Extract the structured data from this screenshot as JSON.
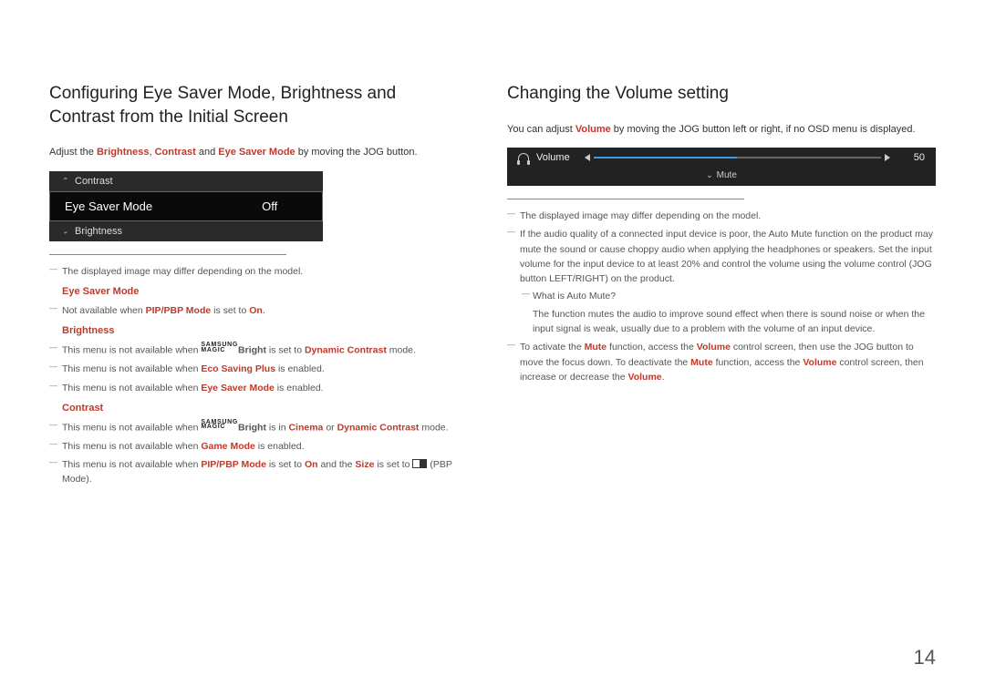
{
  "left": {
    "heading": "Configuring Eye Saver Mode, Brightness and Contrast from the Initial Screen",
    "intro_pre": "Adjust the ",
    "intro_b": "Brightness",
    "intro_c": "Contrast",
    "intro_e": "Eye Saver Mode",
    "intro_post": " by moving the JOG button.",
    "osd": {
      "up": "Contrast",
      "sel_label": "Eye Saver Mode",
      "sel_value": "Off",
      "down": "Brightness"
    },
    "note_model": "The displayed image may differ depending on the model.",
    "sect_esm": "Eye Saver Mode",
    "esm_note_pre": "Not available when ",
    "esm_note_mode": "PIP/PBP Mode",
    "esm_note_mid": " is set to ",
    "esm_note_on": "On",
    "sect_bri": "Brightness",
    "bri1_pre": "This menu is not available when ",
    "bri1_bright": "Bright",
    "bri1_mid": " is set to ",
    "bri1_dc": "Dynamic Contrast",
    "bri1_post": " mode.",
    "bri2_pre": "This menu is not available when ",
    "bri2_eco": "Eco Saving Plus",
    "bri2_post": " is enabled.",
    "bri3_pre": "This menu is not available when ",
    "bri3_esm": "Eye Saver Mode",
    "bri3_post": " is enabled.",
    "sect_con": "Contrast",
    "con1_pre": "This menu is not available when ",
    "con1_bright": "Bright",
    "con1_mid": " is in ",
    "con1_cin": "Cinema",
    "con1_or": " or ",
    "con1_dc": "Dynamic Contrast",
    "con1_post": " mode.",
    "con2_pre": "This menu is not available when ",
    "con2_gm": "Game Mode",
    "con2_post": " is enabled.",
    "con3_pre": "This menu is not available when ",
    "con3_pip": "PIP/PBP Mode",
    "con3_mid1": " is set to ",
    "con3_on": "On",
    "con3_mid2": " and the ",
    "con3_size": "Size",
    "con3_mid3": " is set to ",
    "con3_post": " (PBP Mode)."
  },
  "right": {
    "heading": "Changing the Volume setting",
    "intro_pre": "You can adjust ",
    "intro_vol": "Volume",
    "intro_post": " by moving the JOG button left or right, if no OSD menu is displayed.",
    "osd": {
      "label": "Volume",
      "value": "50",
      "mute": "Mute"
    },
    "note_model": "The displayed image may differ depending on the model.",
    "audio_note": "If the audio quality of a connected input device is poor, the Auto Mute function on the product may mute the sound or cause choppy audio when applying the headphones or speakers. Set the input volume for the input device to at least 20% and control the volume using the volume control (JOG button LEFT/RIGHT) on the product.",
    "automute_q": "What is Auto Mute?",
    "automute_a": "The function mutes the audio to improve sound effect when there is sound noise or when the input signal is weak, usually due to a problem with the volume of an input device.",
    "act_pre": "To activate the ",
    "act_mute1": "Mute",
    "act_mid1": " function, access the ",
    "act_vol1": "Volume",
    "act_mid2": " control screen, then use the JOG button to move the focus down. To deactivate the ",
    "act_mute2": "Mute",
    "act_mid3": " function, access the ",
    "act_vol2": "Volume",
    "act_mid4": " control screen, then increase or decrease the ",
    "act_vol3": "Volume",
    "act_post": "."
  },
  "page": "14",
  "magic_top": "SAMSUNG",
  "magic_bot": "MAGIC"
}
